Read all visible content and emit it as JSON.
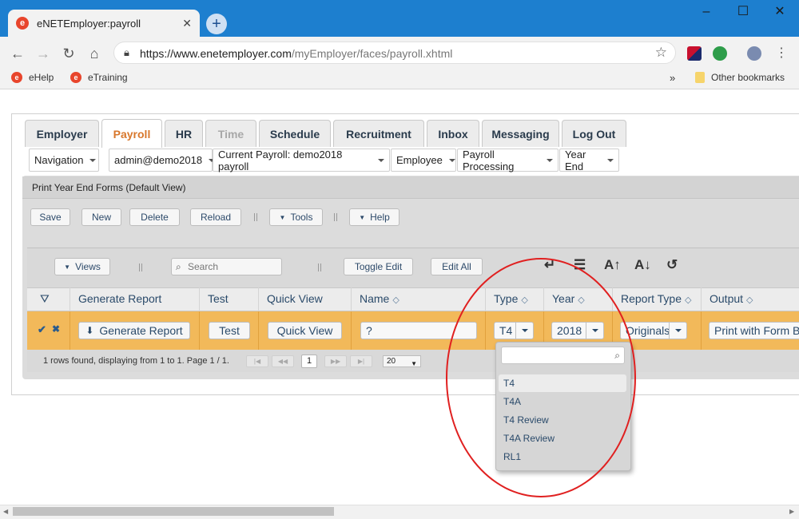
{
  "browser": {
    "tab_title": "eNETEmployer:payroll",
    "url_host": "https://www.enetemployer.com",
    "url_path": "/myEmployer/faces/payroll.xhtml",
    "bookmarks": [
      "eHelp",
      "eTraining"
    ],
    "other_bookmarks": "Other bookmarks"
  },
  "app_tabs": [
    "Employer",
    "Payroll",
    "HR",
    "Time",
    "Schedule",
    "Recruitment",
    "Inbox",
    "Messaging",
    "Log Out"
  ],
  "active_tab": "Payroll",
  "disabled_tab": "Time",
  "menubar": [
    "Navigation",
    "admin@demo2018",
    "Current Payroll: demo2018 payroll",
    "Employee",
    "Payroll Processing",
    "Year End"
  ],
  "panel": {
    "title": "Print Year End Forms (Default View)",
    "buttons": [
      "Save",
      "New",
      "Delete",
      "Reload",
      "Tools",
      "Help"
    ]
  },
  "grid_toolbar": {
    "views": "Views",
    "search_placeholder": "Search",
    "toggle_edit": "Toggle Edit",
    "edit_all": "Edit All"
  },
  "columns": [
    "Generate Report",
    "Test",
    "Quick View",
    "Name",
    "Type",
    "Year",
    "Report Type",
    "Output"
  ],
  "row": {
    "generate_report": "Generate Report",
    "test": "Test",
    "quick_view": "Quick View",
    "name": "?",
    "type": "T4",
    "year": "2018",
    "report_type": "Originals",
    "output": "Print with Form Bac"
  },
  "pager": {
    "text": "1 rows found, displaying from 1 to 1. Page 1 / 1.",
    "current_page": "1",
    "page_size": "20"
  },
  "type_dropdown": {
    "options": [
      "T4",
      "T4A",
      "T4 Review",
      "T4A Review",
      "RL1"
    ],
    "selected": "T4"
  },
  "colors": {
    "accent": "#d8772c",
    "row_highlight": "#f2b95a",
    "annotation": "#e02020",
    "titlebar": "#1d7fcf"
  }
}
